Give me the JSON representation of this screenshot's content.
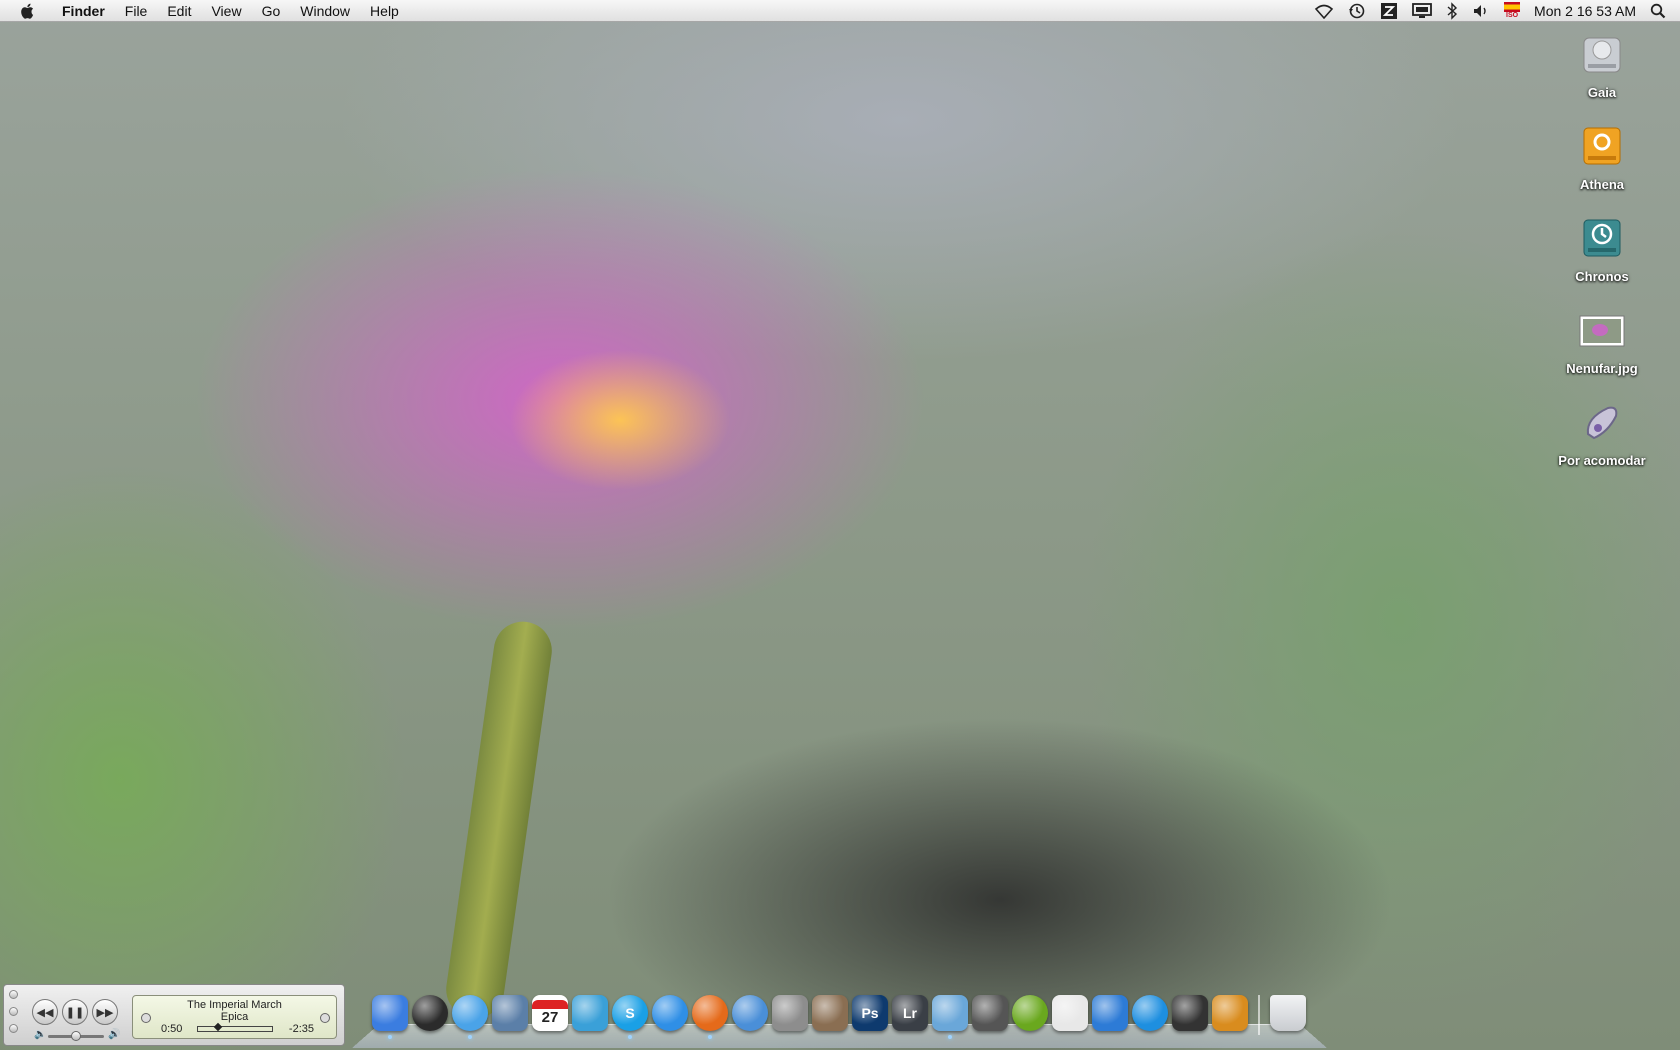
{
  "menubar": {
    "app_name": "Finder",
    "items": [
      "File",
      "Edit",
      "View",
      "Go",
      "Window",
      "Help"
    ],
    "clock": "Mon 2 16 53 AM",
    "status_icons": [
      "wifi-icon",
      "time-machine-icon",
      "app-menu-icon",
      "display-icon",
      "bluetooth-icon",
      "volume-icon",
      "input-flag-icon",
      "spotlight-icon"
    ],
    "flag_label": "ISO"
  },
  "desktop": {
    "icons": [
      {
        "label": "Gaia",
        "icon": "hard-drive-icon"
      },
      {
        "label": "Athena",
        "icon": "firewire-drive-icon"
      },
      {
        "label": "Chronos",
        "icon": "time-machine-drive-icon"
      },
      {
        "label": "Nenufar.jpg",
        "icon": "image-file-icon"
      },
      {
        "label": "Por acomodar",
        "icon": "alias-folder-icon"
      }
    ]
  },
  "mini_player": {
    "track_title": "The Imperial March",
    "artist": "Epica",
    "elapsed": "0:50",
    "remaining": "-2:35",
    "progress_fraction": 0.24,
    "volume_fraction": 0.5
  },
  "dock": {
    "items": [
      {
        "name": "finder-icon",
        "color": "#3b7de0",
        "running": true
      },
      {
        "name": "dashboard-icon",
        "color": "#2b2b2b",
        "running": false
      },
      {
        "name": "itunes-icon",
        "color": "#4aa3e8",
        "running": true
      },
      {
        "name": "mail-icon",
        "color": "#5b7fa8",
        "running": false
      },
      {
        "name": "ical-icon",
        "color": "#ffffff",
        "running": false,
        "text": "27"
      },
      {
        "name": "messenger-icon",
        "color": "#3aa0d8",
        "running": false
      },
      {
        "name": "skype-icon",
        "color": "#1aa0e6",
        "running": true,
        "text": "S"
      },
      {
        "name": "ichat-icon",
        "color": "#2f8fe6",
        "running": false
      },
      {
        "name": "firefox-icon",
        "color": "#e56a1a",
        "running": true
      },
      {
        "name": "safari-icon",
        "color": "#4a8fd8",
        "running": false
      },
      {
        "name": "image-capture-icon",
        "color": "#8d8d8d",
        "running": false
      },
      {
        "name": "iphoto-icon",
        "color": "#8a6e52",
        "running": false
      },
      {
        "name": "photoshop-icon",
        "color": "#0e3a6e",
        "running": false,
        "text": "Ps"
      },
      {
        "name": "lightroom-icon",
        "color": "#3a3f46",
        "running": false,
        "text": "Lr"
      },
      {
        "name": "preview-icon",
        "color": "#6aa7d9",
        "running": true
      },
      {
        "name": "imovie-icon",
        "color": "#555",
        "running": false
      },
      {
        "name": "camino-icon",
        "color": "#6aa81e",
        "running": false
      },
      {
        "name": "textedit-icon",
        "color": "#e8e8e8",
        "running": false
      },
      {
        "name": "word-icon",
        "color": "#2d7bd6",
        "running": false
      },
      {
        "name": "quicktime-icon",
        "color": "#1e8fe0",
        "running": false
      },
      {
        "name": "finalcut-icon",
        "color": "#333",
        "running": false
      },
      {
        "name": "cocktail-icon",
        "color": "#d98c1e",
        "running": false
      }
    ],
    "trash": {
      "name": "trash-icon",
      "color": "#c9ccd0"
    }
  }
}
